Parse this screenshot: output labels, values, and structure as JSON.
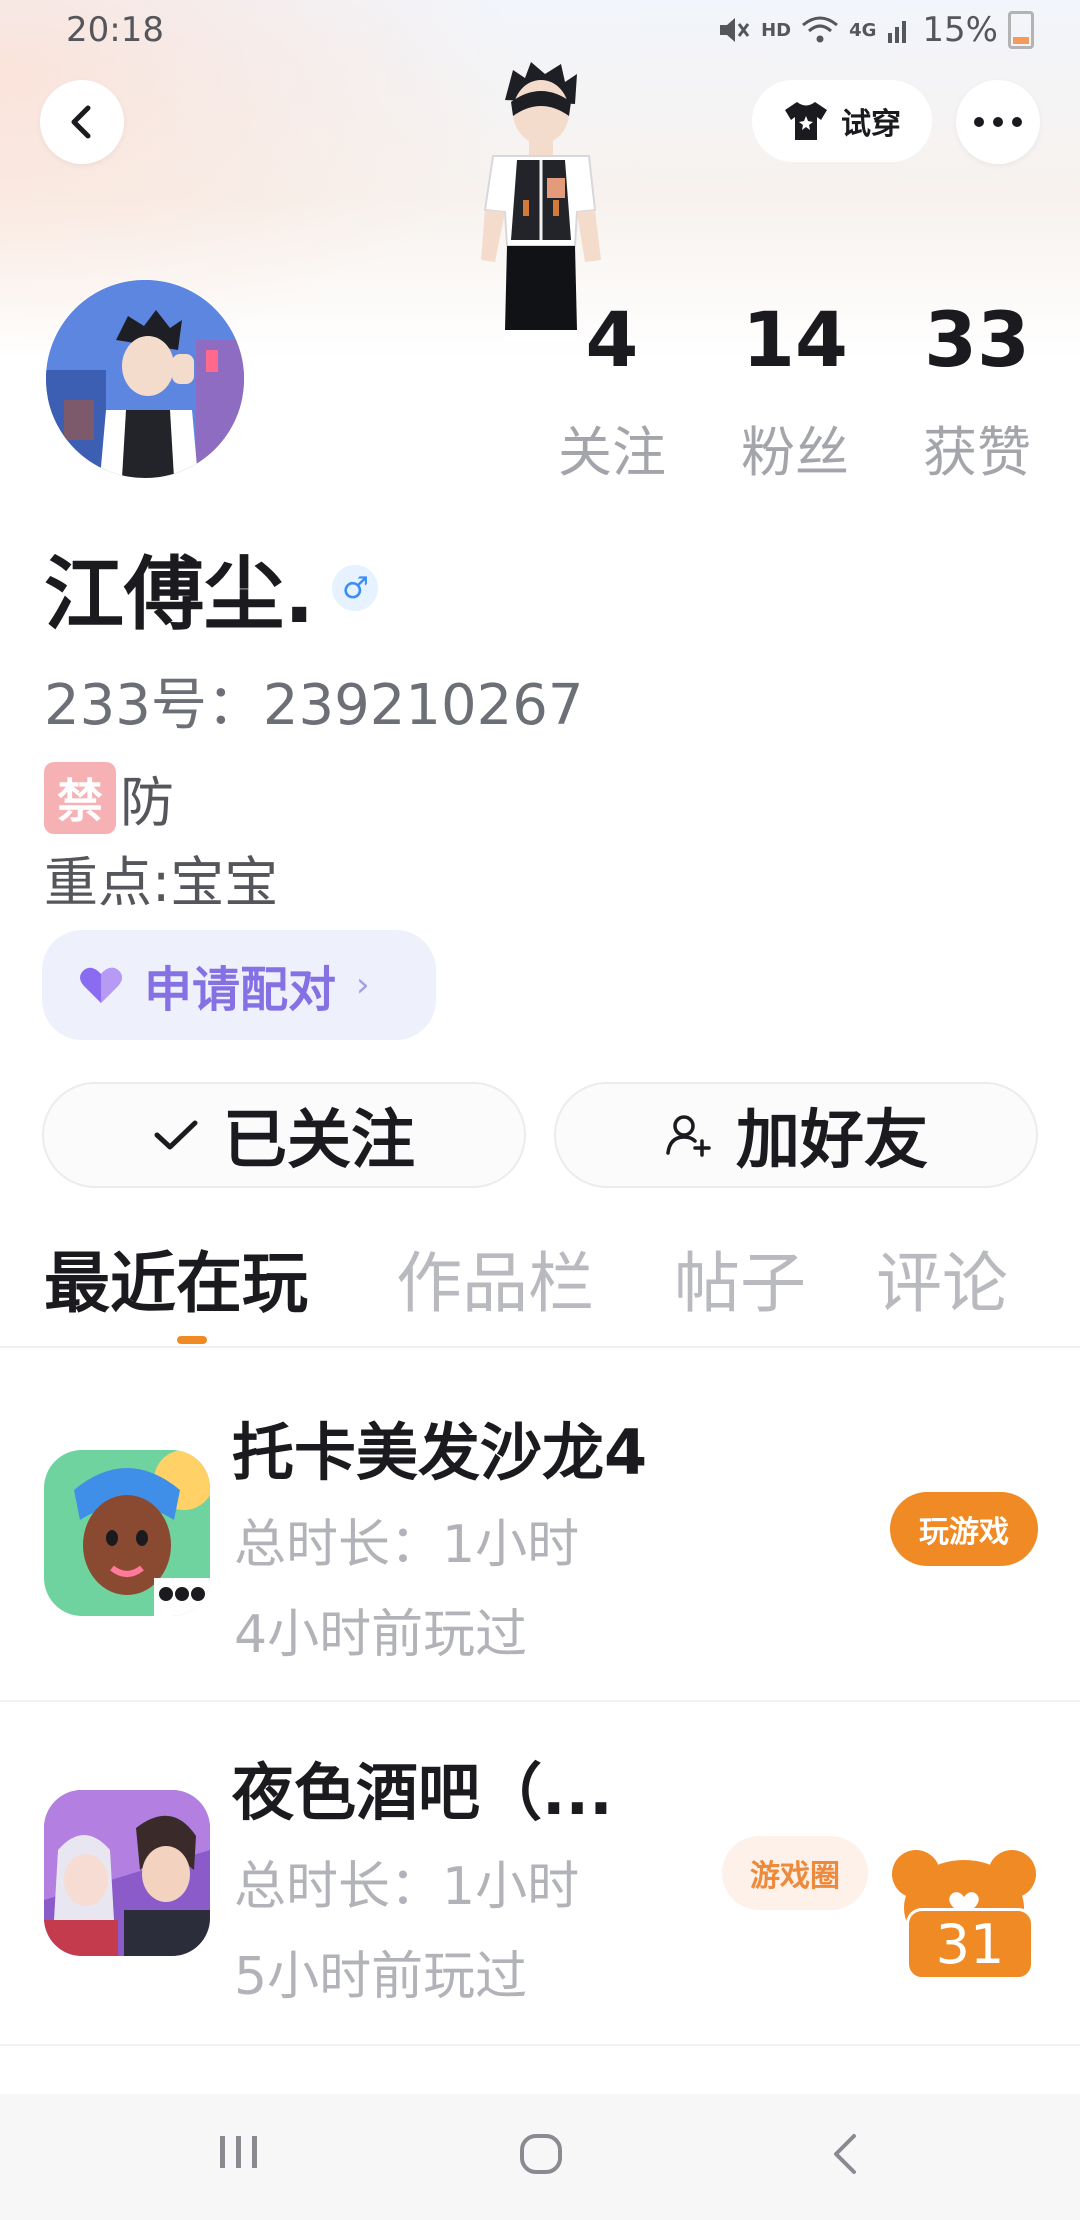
{
  "status_bar": {
    "time": "20:18",
    "network": "4G",
    "hd": "HD",
    "battery": "15%"
  },
  "header": {
    "tryon_label": "试穿"
  },
  "profile": {
    "nickname": "江傅尘.",
    "gender_symbol": "♂",
    "uid": "233号：239210267",
    "bio_emoji": "禁",
    "bio_line1": "防",
    "bio_line2": "重点:宝宝"
  },
  "stats": [
    {
      "value": "4",
      "label": "关注"
    },
    {
      "value": "14",
      "label": "粉丝"
    },
    {
      "value": "33",
      "label": "获赞"
    }
  ],
  "pair_button": {
    "label": "申请配对",
    "chevron": "›"
  },
  "actions": {
    "followed_label": "已关注",
    "add_friend_label": "加好友"
  },
  "tabs": [
    {
      "label": "最近在玩",
      "active": true
    },
    {
      "label": "作品栏",
      "active": false
    },
    {
      "label": "帖子",
      "active": false
    },
    {
      "label": "评论",
      "active": false
    }
  ],
  "games": [
    {
      "title": "托卡美发沙龙4",
      "duration": "总时长：1小时",
      "last_played": "4小时前玩过",
      "button": "玩游戏"
    },
    {
      "title": "夜色酒吧（...",
      "duration": "总时长：1小时",
      "last_played": "5小时前玩过",
      "circle_button": "游戏圈"
    }
  ],
  "floating_widget": {
    "count": "31"
  },
  "colors": {
    "accent_orange": "#f08a24",
    "pair_purple": "#8571e4",
    "gender_blue": "#3a8ef6"
  },
  "icons": {
    "back": "chevron-left-icon",
    "more": "more-dots-icon",
    "tryon": "tshirt-icon",
    "followed": "check-icon",
    "add_friend": "add-person-icon",
    "pair": "heart-icon"
  }
}
